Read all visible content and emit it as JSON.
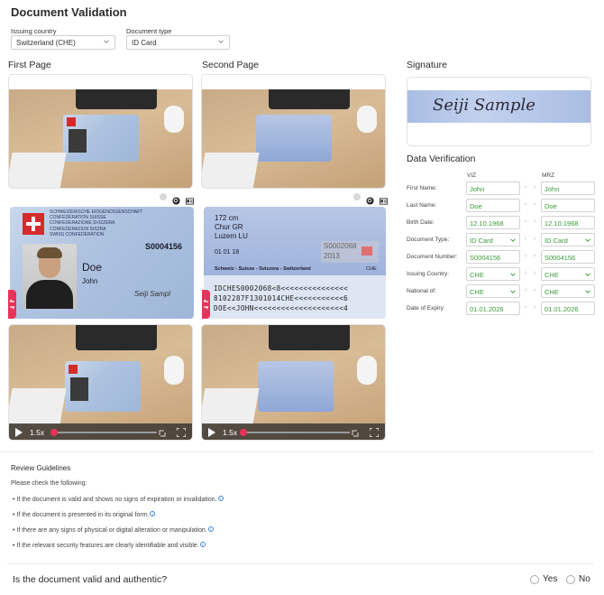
{
  "title": "Document Validation",
  "issuing_country": {
    "label": "Issuing country",
    "value": "Switzerland (CHE)"
  },
  "document_type": {
    "label": "Document type",
    "value": "ID Card"
  },
  "first_page": {
    "label": "First Page",
    "speed": "1.5x"
  },
  "second_page": {
    "label": "Second Page",
    "speed": "1.5x"
  },
  "card_front": {
    "header": [
      "SCHWEIZERISCHE EIDGENOSSENSCHAFT",
      "CONFÉDÉRATION SUISSE",
      "CONFEDERAZIONE SVIZZERA",
      "CONFEDERAZIUN SVIZRA",
      "SWISS CONFEDERATION"
    ],
    "number": "S0004156",
    "surname": "Doe",
    "given": "John",
    "signature": "Seiji Sampl"
  },
  "card_back": {
    "height": "172 cm",
    "place": "Chur GR",
    "authority": "Luzern LU",
    "date": "01 01 18",
    "number_overlay": "S0002068",
    "year_overlay": "2013",
    "footer": "Schweiz - Suisse - Svizzera - Switzerland",
    "country": "CHE",
    "mrz": [
      "IDCHES0002068<8<<<<<<<<<<<<<<<",
      "8102287F1301014CHE<<<<<<<<<<<6",
      "DOE<<JOHN<<<<<<<<<<<<<<<<<<<<4"
    ]
  },
  "signature": {
    "label": "Signature",
    "text": "Seiji Sample"
  },
  "data_verification": {
    "label": "Data Verification",
    "col_viz": "VIZ",
    "col_mrz": "MRZ",
    "rows": [
      {
        "label": "First Name:",
        "viz": "John",
        "mrz": "John",
        "select": false
      },
      {
        "label": "Last Name:",
        "viz": "Doe",
        "mrz": "Doe",
        "select": false
      },
      {
        "label": "Birth Date:",
        "viz": "12.10.1968",
        "mrz": "12.10.1968",
        "select": false
      },
      {
        "label": "Document Type:",
        "viz": "ID Card",
        "mrz": "ID Card",
        "select": true
      },
      {
        "label": "Document Number:",
        "viz": "S0004156",
        "mrz": "S0004156",
        "select": false
      },
      {
        "label": "Issuing Country:",
        "viz": "CHE",
        "mrz": "CHE",
        "select": true
      },
      {
        "label": "National of:",
        "viz": "CHE",
        "mrz": "CHE",
        "select": true
      },
      {
        "label": "Date of Expiry:",
        "viz": "01.01.2026",
        "mrz": "01.01.2026",
        "select": false
      }
    ]
  },
  "review": {
    "title": "Review Guidelines",
    "intro": "Please check the following:",
    "items": [
      "If the document is valid and shows no signs of expiration or invalidation.",
      "If the document is presented in its original form.",
      "If there are any signs of physical or digital alteration or manipulation.",
      "If the relevant security features are clearly identifiable and visible."
    ]
  },
  "question": {
    "text": "Is the document valid and authentic?",
    "yes": "Yes",
    "no": "No"
  },
  "colors": {
    "accent": "#e8325a",
    "valid_text": "#3a9a3a",
    "info": "#3a8ad8"
  }
}
